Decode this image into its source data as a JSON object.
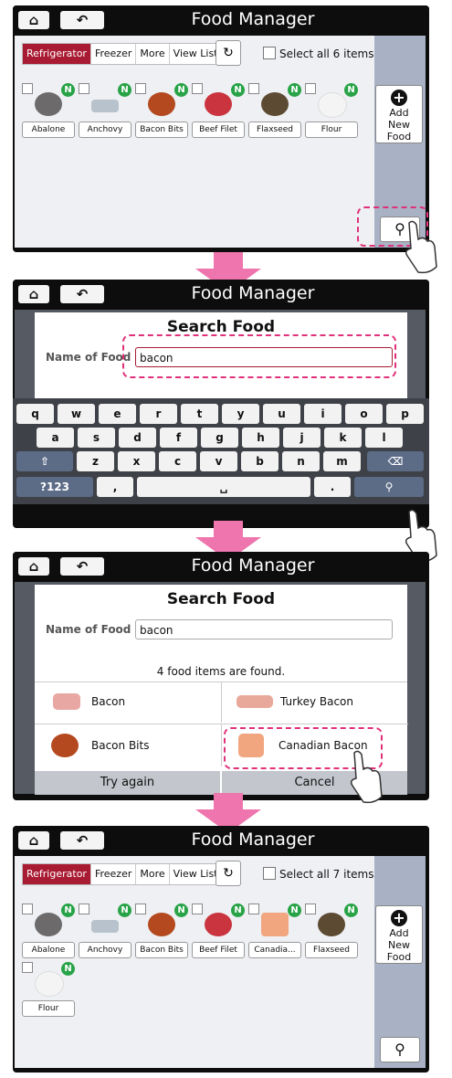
{
  "app": {
    "title": "Food Manager"
  },
  "tabs": [
    "Refrigerator",
    "Freezer",
    "More",
    "View List"
  ],
  "screen1": {
    "select_all": "Select all 6 items",
    "items": [
      "Abalone",
      "Anchovy",
      "Bacon Bits",
      "Beef Filet",
      "Flaxseed",
      "Flour"
    ],
    "badge": "N",
    "add_label_1": "Add",
    "add_label_2": "New Food"
  },
  "search": {
    "title": "Search Food",
    "field_label": "Name of Food",
    "value": "bacon",
    "found": "4 food items are found.",
    "results": [
      "Bacon",
      "Turkey Bacon",
      "Bacon Bits",
      "Canadian Bacon"
    ],
    "try_again": "Try again",
    "cancel": "Cancel"
  },
  "keyboard": {
    "row1": [
      "q",
      "w",
      "e",
      "r",
      "t",
      "y",
      "u",
      "i",
      "o",
      "p"
    ],
    "row2": [
      "a",
      "s",
      "d",
      "f",
      "g",
      "h",
      "j",
      "k",
      "l"
    ],
    "row3": [
      "z",
      "x",
      "c",
      "v",
      "b",
      "n",
      "m"
    ],
    "sym": "?123",
    "comma": ",",
    "period": "."
  },
  "screen4": {
    "select_all": "Select all 7 items",
    "items": [
      "Abalone",
      "Anchovy",
      "Bacon Bits",
      "Beef Filet",
      "Canadia...",
      "Flaxseed",
      "Flour"
    ]
  },
  "colors": {
    "accent": "#a81b32",
    "highlight": "#e0307a",
    "badge": "#29a347",
    "arrow": "#ee75ad"
  }
}
